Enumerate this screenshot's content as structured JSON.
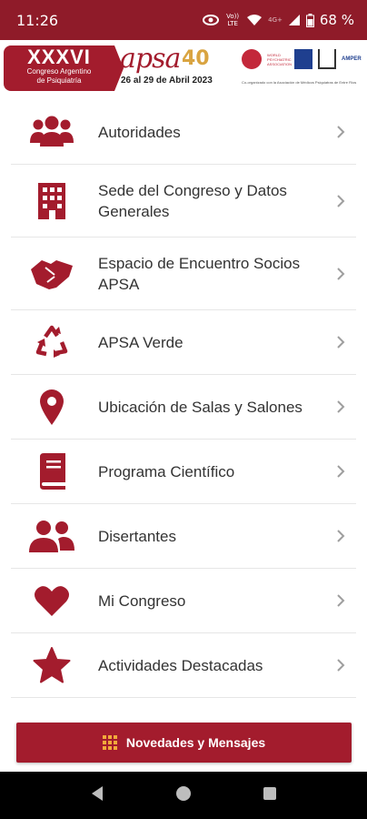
{
  "status_bar": {
    "time": "11:26",
    "volte_label": "Vo)) LTE",
    "network_label": "4G+",
    "battery": "68 %"
  },
  "banner": {
    "congress_number": "XXXVI",
    "congress_line1": "Congreso Argentino",
    "congress_line2": "de Psiquiatría",
    "org_logo_text": "apsa",
    "anniversary": "40",
    "dates": "26 al 29 de Abril 2023",
    "partner1": "WORLD PSYCHIATRIC ASSOCIATION",
    "partner4": "AMPER",
    "footer": "Co-organizado con la Asociación de Médicos Psiquiatras de Entre Ríos"
  },
  "menu": {
    "items": [
      {
        "label": "Autoridades",
        "icon": "users-icon"
      },
      {
        "label": "Sede del Congreso y Datos Generales",
        "icon": "building-icon"
      },
      {
        "label": "Espacio de Encuentro Socios APSA",
        "icon": "handshake-icon"
      },
      {
        "label": "APSA Verde",
        "icon": "recycle-icon"
      },
      {
        "label": "Ubicación de Salas y Salones",
        "icon": "map-marker-icon"
      },
      {
        "label": "Programa Científico",
        "icon": "book-icon"
      },
      {
        "label": "Disertantes",
        "icon": "user-friends-icon"
      },
      {
        "label": "Mi Congreso",
        "icon": "heart-icon"
      },
      {
        "label": "Actividades Destacadas",
        "icon": "star-icon"
      }
    ]
  },
  "news_button": {
    "label": "Novedades y Mensajes",
    "icon": "grid-icon"
  },
  "colors": {
    "brand": "#a31c2d",
    "statusbar": "#8f1b29",
    "accent": "#f2a93b",
    "chevron": "#9e9e9e"
  }
}
